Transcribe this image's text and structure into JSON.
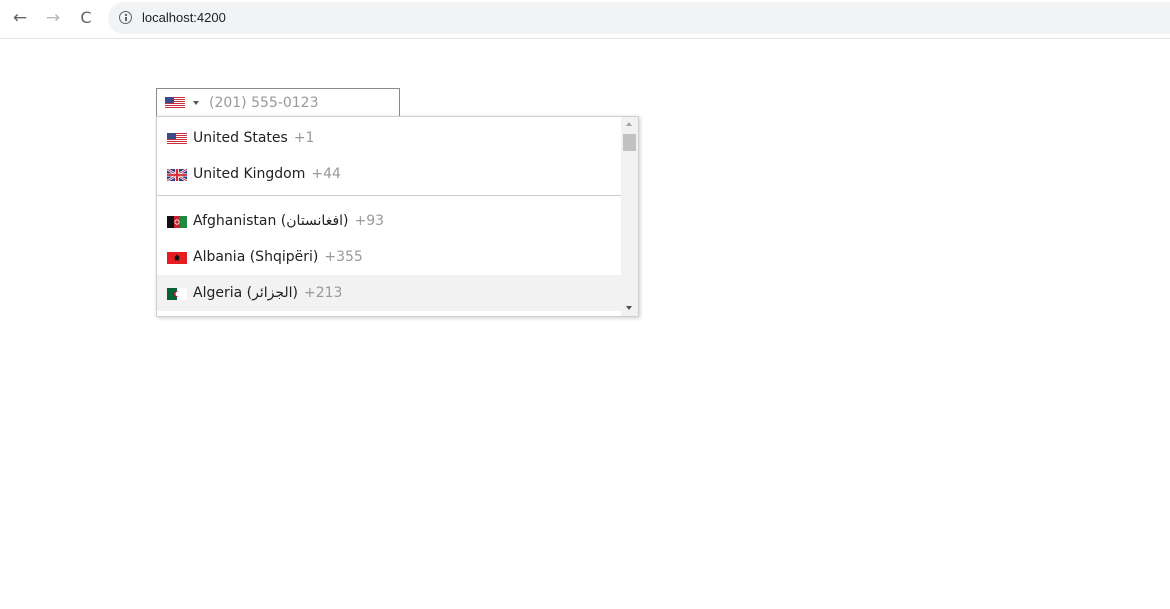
{
  "browser": {
    "url": "localhost:4200"
  },
  "phone_input": {
    "selected_country": "us",
    "placeholder": "(201) 555-0123",
    "value": ""
  },
  "country_list": {
    "preferred": [
      {
        "flag": "us-flag-icon",
        "name": "United States",
        "dial_code": "+1"
      },
      {
        "flag": "gb-flag-icon",
        "name": "United Kingdom",
        "dial_code": "+44"
      }
    ],
    "countries": [
      {
        "flag": "af-flag-icon",
        "name": "Afghanistan (‫افغانستان‬‎)",
        "dial_code": "+93"
      },
      {
        "flag": "al-flag-icon",
        "name": "Albania (Shqipëri)",
        "dial_code": "+355"
      },
      {
        "flag": "dz-flag-icon",
        "name": "Algeria (‫الجزائر‬‎)",
        "dial_code": "+213",
        "highlighted": true
      }
    ]
  },
  "colors": {
    "highlight_bg": "#f2f2f2",
    "dial_code": "#999999",
    "placeholder": "#999999"
  }
}
